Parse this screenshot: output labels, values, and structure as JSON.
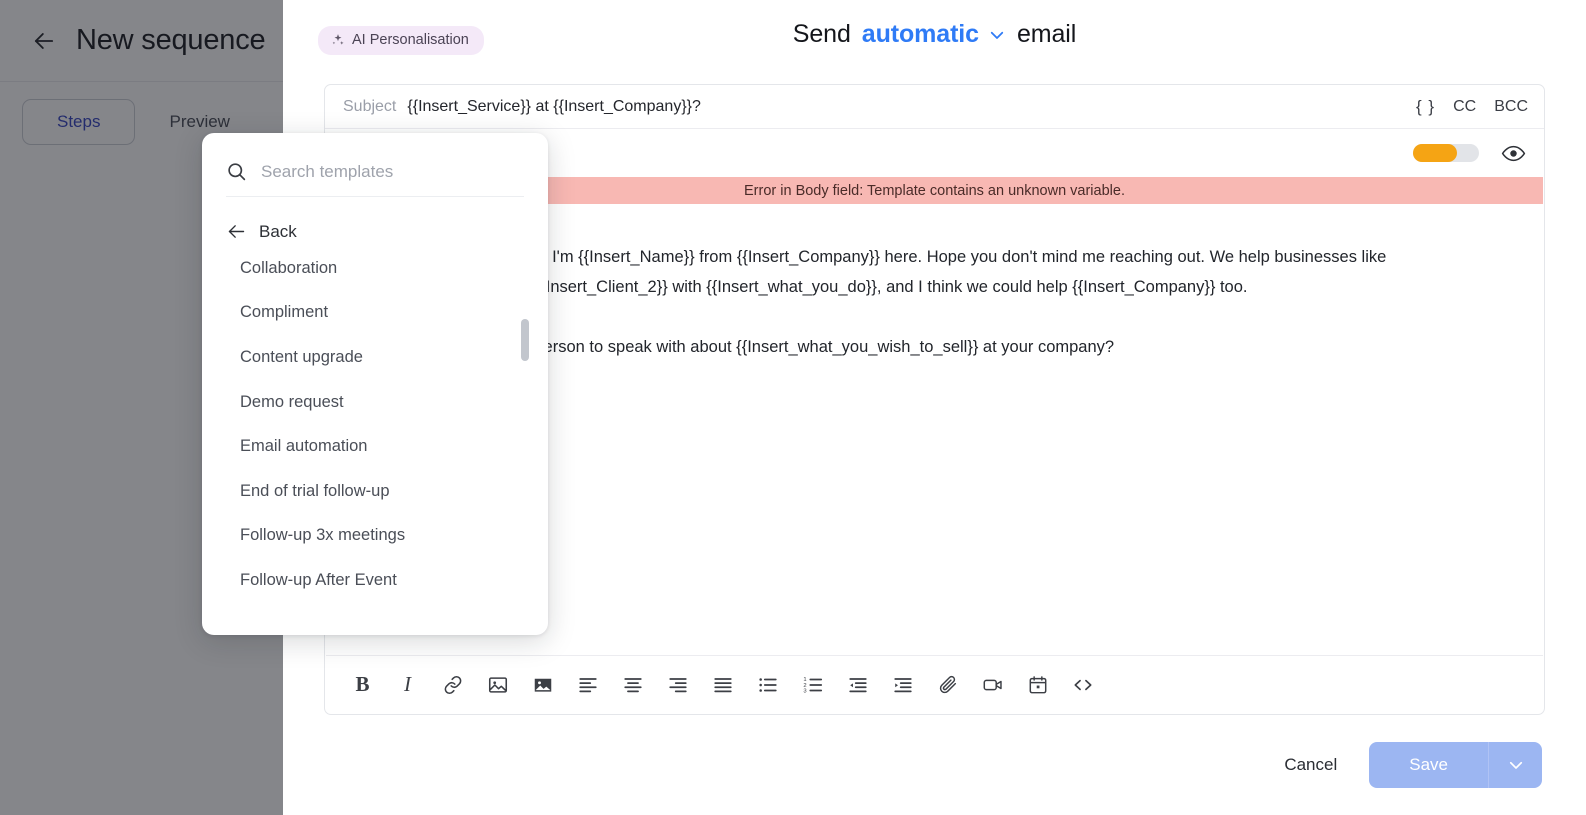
{
  "left_panel": {
    "back_icon": "arrow-left-icon",
    "title": "New sequence",
    "tabs": [
      {
        "label": "Steps",
        "active": true
      },
      {
        "label": "Preview",
        "active": false
      }
    ]
  },
  "main": {
    "ai_badge": {
      "icon": "sparkle-icon",
      "label": "AI Personalisation"
    },
    "send_line": {
      "prefix": "Send",
      "mode": "automatic",
      "caret_icon": "chevron-down-icon",
      "suffix": "email"
    },
    "compose": {
      "subject": {
        "label": "Subject",
        "value": "{{Insert_Service}} at {{Insert_Company}}?",
        "placeholder": "Subject"
      },
      "subject_tools": {
        "braces_icon": "{ }",
        "cc_label": "CC",
        "bcc_label": "BCC"
      },
      "meta_row": {
        "toggle_name": "ai-personalisation-toggle",
        "toggle_state": "on",
        "toggle_color": "#f5a414",
        "eye_icon": "eye-icon"
      },
      "error_banner": {
        "text": "Error in Body field: Template contains an unknown variable.",
        "background": "#f8b8b3"
      },
      "body_paragraphs": [
        "Hi {{Insert_First_Name}}, I'm {{Insert_Name}} from {{Insert_Company}} here. Hope you don't mind me reaching out. We help businesses like {{Insert_Client_1}} and {{Insert_Client_2}} with {{Insert_what_you_do}}, and I think we could help {{Insert_Company}} too.",
        "Would you be the right person to speak with about {{Insert_what_you_wish_to_sell}} at your company?"
      ],
      "toolbar": [
        {
          "name": "bold-button",
          "glyph": "B",
          "kind": "glyph-bold"
        },
        {
          "name": "italic-button",
          "glyph": "I",
          "kind": "glyph-italic"
        },
        {
          "name": "link-icon",
          "kind": "svg"
        },
        {
          "name": "image-icon",
          "kind": "svg"
        },
        {
          "name": "image-filled-icon",
          "kind": "svg"
        },
        {
          "name": "align-left-icon",
          "kind": "svg"
        },
        {
          "name": "align-center-icon",
          "kind": "svg"
        },
        {
          "name": "align-right-icon",
          "kind": "svg"
        },
        {
          "name": "align-justify-icon",
          "kind": "svg"
        },
        {
          "name": "bulleted-list-icon",
          "kind": "svg"
        },
        {
          "name": "numbered-list-icon",
          "kind": "svg"
        },
        {
          "name": "outdent-icon",
          "kind": "svg"
        },
        {
          "name": "indent-icon",
          "kind": "svg"
        },
        {
          "name": "attachment-icon",
          "kind": "svg"
        },
        {
          "name": "video-icon",
          "kind": "svg"
        },
        {
          "name": "calendar-icon",
          "kind": "svg"
        },
        {
          "name": "code-icon",
          "kind": "svg"
        }
      ]
    },
    "actions": {
      "cancel_label": "Cancel",
      "save_label": "Save",
      "save_caret_icon": "chevron-down-icon",
      "save_color": "#9cb6f2"
    }
  },
  "templates_popover": {
    "search": {
      "icon": "search-icon",
      "placeholder": "Search templates",
      "value": ""
    },
    "back": {
      "icon": "arrow-left-icon",
      "label": "Back"
    },
    "items": [
      {
        "label": "Collaboration",
        "clipped": true
      },
      {
        "label": "Compliment",
        "clipped": false
      },
      {
        "label": "Content upgrade",
        "clipped": false
      },
      {
        "label": "Demo request",
        "clipped": false
      },
      {
        "label": "Email automation",
        "clipped": false
      },
      {
        "label": "End of trial follow-up",
        "clipped": false
      },
      {
        "label": "Follow-up 3x meetings",
        "clipped": false
      },
      {
        "label": "Follow-up After Event",
        "clipped": false
      }
    ],
    "scrollbar": {
      "name": "templates-scrollbar"
    }
  }
}
